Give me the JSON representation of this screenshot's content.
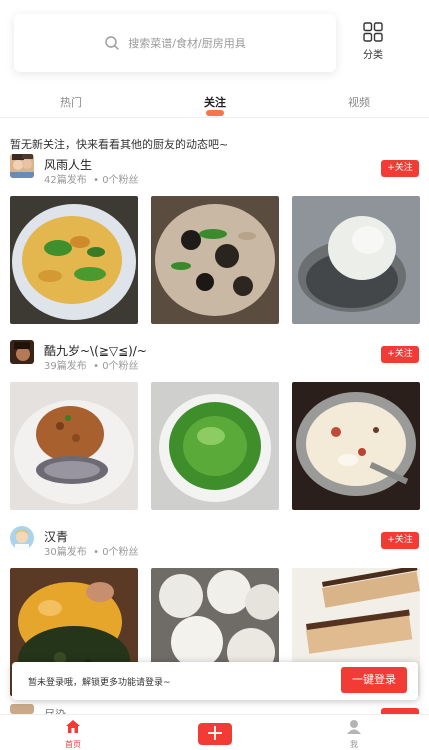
{
  "search": {
    "placeholder": "搜索菜谱/食材/厨房用具"
  },
  "category": {
    "label": "分类"
  },
  "tabs": [
    {
      "label": "热门"
    },
    {
      "label": "关注"
    },
    {
      "label": "视频"
    }
  ],
  "notice": "暂无新关注，快来看看其他的厨友的动态吧~",
  "users": [
    {
      "name": "风雨人生",
      "posts": "42篇发布",
      "fans": "0个粉丝",
      "follow": "+关注"
    },
    {
      "name": "酷九岁~\\(≧▽≦)/~",
      "posts": "39篇发布",
      "fans": "0个粉丝",
      "follow": "+关注"
    },
    {
      "name": "汉青",
      "posts": "30篇发布",
      "fans": "0个粉丝",
      "follow": "+关注"
    }
  ],
  "stats_separator": "•",
  "partial_user": {
    "name": "尽染"
  },
  "login_banner": {
    "text": "暂未登录哦，解锁更多功能请登录~",
    "button": "一键登录"
  },
  "bottom_nav": {
    "home": "首页",
    "add": "+",
    "me": "我"
  },
  "colors": {
    "accent": "#f23b35",
    "tab_underline": "#f55e2d"
  }
}
